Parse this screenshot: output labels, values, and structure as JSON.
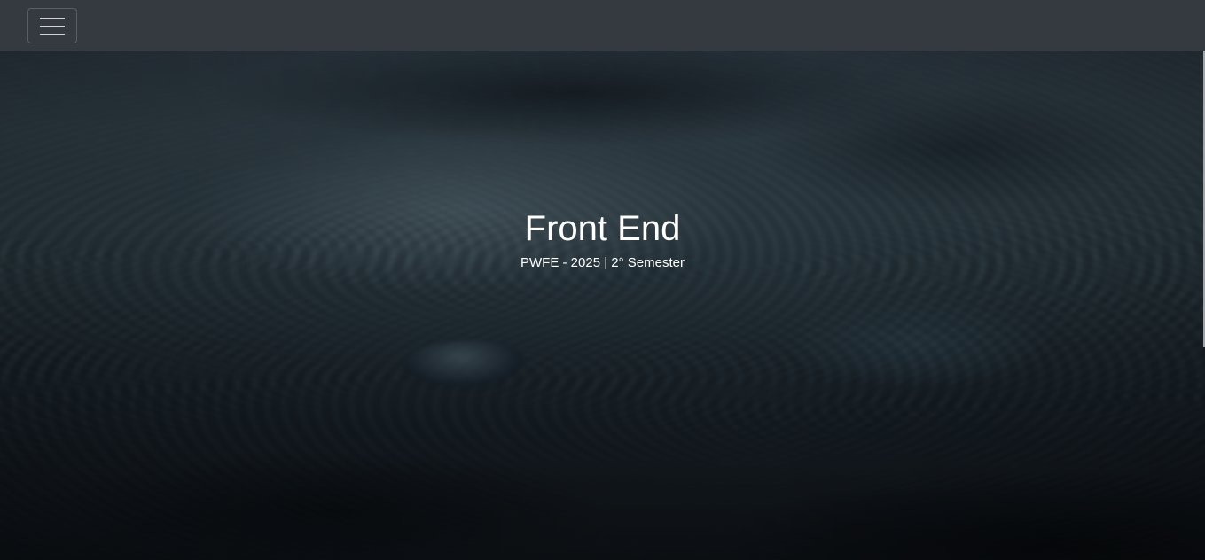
{
  "navbar": {
    "menu_icon": "hamburger-menu-icon",
    "background": "#343a40"
  },
  "hero": {
    "title": "Front End",
    "subtitle": "PWFE - 2025 | 2° Semester",
    "text_color": "#ffffff"
  }
}
